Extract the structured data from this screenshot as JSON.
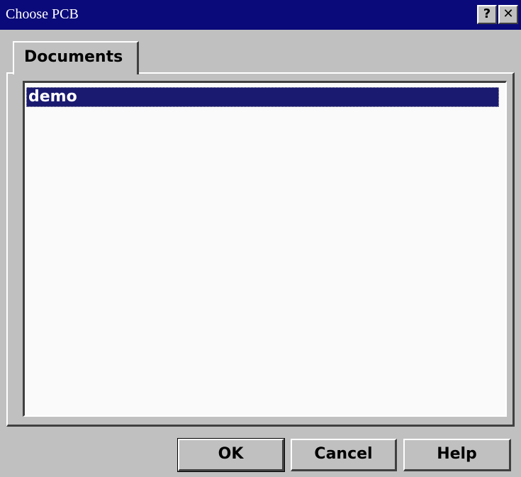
{
  "window": {
    "title": "Choose PCB",
    "help_glyph": "?",
    "close_glyph": "✕"
  },
  "tabs": [
    {
      "label": "Documents",
      "selected": true
    }
  ],
  "list": {
    "items": [
      {
        "label": "demo",
        "selected": true
      }
    ]
  },
  "buttons": {
    "ok": "OK",
    "cancel": "Cancel",
    "help": "Help"
  },
  "colors": {
    "titlebar": "#0a0a7a",
    "selection": "#1a1a70",
    "face": "#c0c0c0"
  }
}
